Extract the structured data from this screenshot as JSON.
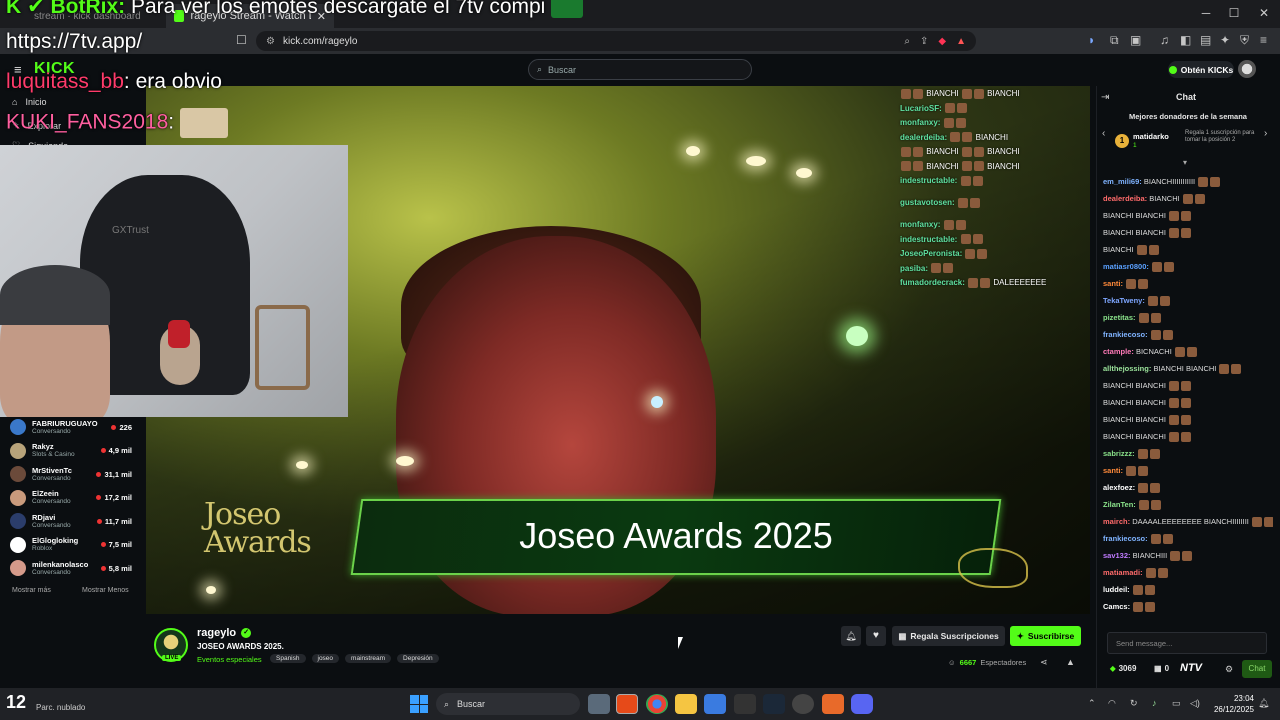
{
  "browser": {
    "tabs": [
      {
        "label": "stream · kick dashboard",
        "active": false
      },
      {
        "label": "rageylo Stream - Watch Live",
        "active": true
      }
    ],
    "url": "kick.com/rageylo"
  },
  "overlay_texts": {
    "botrix_user": "BotRix:",
    "botrix_msg": "Para ver los emotes descargate el 7tv compi",
    "link": "https://7tv.app/",
    "line1_user": "luquitass_bb",
    "line1_msg": ": era obvio",
    "line2_user": "KUKI_FANS2018"
  },
  "kick": {
    "logo": "KICK",
    "search_placeholder": "Buscar",
    "get_kicks": "Obtén KICKs",
    "nav": [
      "Inicio",
      "Explorar",
      "Siguiendo"
    ]
  },
  "sidebar": {
    "channels": [
      {
        "name": "FABRIURUGUAYO",
        "sub": "Conversando",
        "viewers": "226",
        "color": "#3a78c9"
      },
      {
        "name": "Rakyz",
        "sub": "Slots & Casino",
        "viewers": "4,9 mil",
        "color": "#b8a37a"
      },
      {
        "name": "MrStivenTc",
        "sub": "Conversando",
        "viewers": "31,1 mil",
        "color": "#6b4a3a"
      },
      {
        "name": "ElZeein",
        "sub": "Conversando",
        "viewers": "17,2 mil",
        "color": "#c99a7c"
      },
      {
        "name": "RDjavi",
        "sub": "Conversando",
        "viewers": "11,7 mil",
        "color": "#2b3d6b"
      },
      {
        "name": "ElGlogloking",
        "sub": "Roblox",
        "viewers": "7,5 mil",
        "color": "#ffffff"
      },
      {
        "name": "milenkanolasco",
        "sub": "Conversando",
        "viewers": "5,8 mil",
        "color": "#d59a8a"
      }
    ],
    "show_more": "Mostrar más",
    "show_less": "Mostrar Menos"
  },
  "video": {
    "banner_title": "Joseo Awards 2025",
    "logo_text": "Joseo\nAwards",
    "overlay_chat": [
      {
        "user": "",
        "msg": "BIANCHI",
        "msg2": "BIANCHI"
      },
      {
        "user": "LucarioSF:",
        "msg": ""
      },
      {
        "user": "monfanxy:",
        "msg": ""
      },
      {
        "user": "dealerdeiba:",
        "msg": "BIANCHI"
      },
      {
        "user": "",
        "msg": "BIANCHI",
        "msg2": "BIANCHI"
      },
      {
        "user": "",
        "msg": "BIANCHI",
        "msg2": "BIANCHI"
      },
      {
        "user": "indestructable:",
        "msg": ""
      },
      {
        "user": "gustavotosen:",
        "msg": ""
      },
      {
        "user": "monfanxy:",
        "msg": ""
      },
      {
        "user": "indestructable:",
        "msg": ""
      },
      {
        "user": "JoseoPeronista:",
        "msg": ""
      },
      {
        "user": "pasiba:",
        "msg": ""
      },
      {
        "user": "fumadordecrack:",
        "msg": "DALEEEEEEE"
      }
    ]
  },
  "stream": {
    "streamer": "rageylo",
    "title": "JOSEO AWARDS 2025.",
    "category": "Eventos especiales",
    "tags": [
      "Spanish",
      "joseo",
      "mainstream",
      "Depresión"
    ],
    "live_badge": "LIVE",
    "gift_subs": "Regala Suscripciones",
    "subscribe": "Suscribirse",
    "viewers": "6667",
    "viewers_label": "Espectadores"
  },
  "chat": {
    "title": "Chat",
    "top_donors_title": "Mejores donadores de la semana",
    "donor_name": "matidarko",
    "donor_count": "1",
    "gift_prompt": "Regala 1 suscripción para tomar la posición 2",
    "messages": [
      {
        "user": "em_mili69:",
        "msg": "BIANCHIIIIIIIIIII",
        "color": "#7fb3ff"
      },
      {
        "user": "dealerdeiba:",
        "msg": "BIANCHI",
        "color": "#ff6b6b"
      },
      {
        "user": "",
        "msg": "BIANCHI        BIANCHI",
        "color": "#ddd"
      },
      {
        "user": "",
        "msg": "BIANCHI        BIANCHI",
        "color": "#ddd"
      },
      {
        "user": "",
        "msg": "BIANCHI",
        "color": "#ddd"
      },
      {
        "user": "matiasr0800:",
        "msg": "",
        "color": "#5aa0ff"
      },
      {
        "user": "santi:",
        "msg": "",
        "color": "#ff8a3a"
      },
      {
        "user": "TekaTweny:",
        "msg": "",
        "color": "#7ea6ff"
      },
      {
        "user": "pizetitas:",
        "msg": "",
        "color": "#8ae28a"
      },
      {
        "user": "frankiecoso:",
        "msg": "",
        "color": "#7fb3ff"
      },
      {
        "user": "ctample:",
        "msg": "BICNACHI",
        "color": "#ff7ab8"
      },
      {
        "user": "allthejossing:",
        "msg": "BIANCHI        BIANCHI",
        "color": "#9be39b"
      },
      {
        "user": "",
        "msg": "BIANCHI        BIANCHI",
        "color": "#ddd"
      },
      {
        "user": "",
        "msg": "BIANCHI        BIANCHI",
        "color": "#ddd"
      },
      {
        "user": "",
        "msg": "BIANCHI        BIANCHI",
        "color": "#ddd"
      },
      {
        "user": "",
        "msg": "BIANCHI        BIANCHI",
        "color": "#ddd"
      },
      {
        "user": "sabrizzz:",
        "msg": "",
        "color": "#8ae28a"
      },
      {
        "user": "santi:",
        "msg": "",
        "color": "#ff8a3a"
      },
      {
        "user": "alexfoez:",
        "msg": "",
        "color": "#ffffff"
      },
      {
        "user": "ZilanTen:",
        "msg": "",
        "color": "#8ae28a"
      },
      {
        "user": "mairch:",
        "msg": "DAAAALEEEEEEEE BIANCHIIIIIIII",
        "color": "#ff6b6b"
      },
      {
        "user": "frankiecoso:",
        "msg": "",
        "color": "#7fb3ff"
      },
      {
        "user": "sav132:",
        "msg": "BIANCHIII",
        "color": "#c07bff"
      },
      {
        "user": "matiamadi:",
        "msg": "",
        "color": "#ff6b6b"
      },
      {
        "user": "luddeil:",
        "msg": "",
        "color": "#ffffff"
      },
      {
        "user": "Camcs:",
        "msg": "",
        "color": "#ffffff"
      }
    ],
    "input_placeholder": "Send message...",
    "points": "3069",
    "zero": "0",
    "brand": "NTV",
    "send": "Chat"
  },
  "taskbar": {
    "search": "Buscar",
    "weather_temp": "12",
    "weather_desc": "Parc. nublado",
    "time": "23:04",
    "date": "26/12/2025"
  },
  "colors": {
    "kick_green": "#53fc18",
    "bg": "#0b0e11"
  }
}
